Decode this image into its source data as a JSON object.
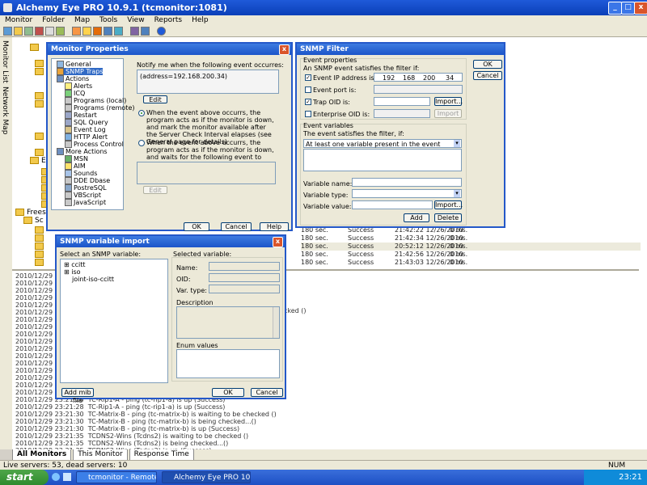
{
  "window": {
    "title": "Alchemy Eye PRO 10.9.1 (tcmonitor:1081)"
  },
  "menu": [
    "Monitor",
    "Folder",
    "Map",
    "Tools",
    "View",
    "Reports",
    "Help"
  ],
  "side_tabs": [
    "Monitor List",
    "Network Map"
  ],
  "tree": [
    {
      "label": "Freeser"
    },
    {
      "label": "Sc"
    }
  ],
  "monitor_rows": [
    {
      "interval": "180 sec.",
      "status": "Success",
      "time": "21:42:22 12/26/2010",
      "resp": "0 ms."
    },
    {
      "interval": "180 sec.",
      "status": "Success",
      "time": "21:42:34 12/26/2010",
      "resp": "0 ms."
    },
    {
      "interval": "180 sec.",
      "status": "Success",
      "time": "20:52:12 12/26/2010",
      "resp": "0 ms."
    },
    {
      "interval": "180 sec.",
      "status": "Success",
      "time": "21:42:56 12/26/2010",
      "resp": "0 ms."
    },
    {
      "interval": "180 sec.",
      "status": "Success",
      "time": "21:43:03 12/26/2010",
      "resp": "0 ms."
    }
  ],
  "log": {
    "dates": [
      "2010/12/29 23:2",
      "2010/12/29 23:2",
      "2010/12/29 23:2",
      "2010/12/29 23:2",
      "2010/12/29 23:2",
      "2010/12/29 23:2",
      "2010/12/29 23:2",
      "2010/12/29 23:2",
      "2010/12/29 23:2",
      "2010/12/29 23:2",
      "2010/12/29 23:2",
      "2010/12/29 23:2",
      "2010/12/29 23:2",
      "2010/12/29 23:2",
      "2010/12/29 23:2",
      "2010/12/29 23:2",
      "2010/12/29 23:2"
    ],
    "rows": [
      {
        "time": "2010/12/29 23:21:28",
        "text": "TC-Rip1-A - ping (tc-rip1-a) is up (Success)"
      },
      {
        "time": "2010/12/29 23:21:28",
        "text": "TC-Rip1-A - ping (tc-rip1-a) is up (Success)"
      },
      {
        "time": "2010/12/29 23:21:30",
        "text": "TC-Matrix-B - ping (tc-matrix-b) is waiting to be checked ()"
      },
      {
        "time": "2010/12/29 23:21:30",
        "text": "TC-Matrix-B - ping (tc-matrix-b) is being checked...()"
      },
      {
        "time": "2010/12/29 23:21:30",
        "text": "TC-Matrix-B - ping (tc-matrix-b) is up (Success)"
      },
      {
        "time": "2010/12/29 23:21:35",
        "text": "TCDNS2-Wins (Tcdns2) is waiting to be checked ()"
      },
      {
        "time": "2010/12/29 23:21:35",
        "text": "TCDNS2-Wins (Tcdns2) is being checked...()"
      },
      {
        "time": "2010/12/29 23:21:35",
        "text": "TCDNS2-Wins (Tcdns2) is up (Success)"
      }
    ],
    "fragment": "cked ()"
  },
  "tabs": [
    "All Monitors",
    "This Monitor",
    "Response Time"
  ],
  "statusbar": {
    "left": "Live servers: 53, dead servers: 10",
    "right": "NUM"
  },
  "taskbar": {
    "start": "start",
    "items": [
      "tcmonitor - Remote D...",
      "Alchemy Eye PRO 10...."
    ],
    "clock": "23:21"
  },
  "monitor_props": {
    "title": "Monitor Properties",
    "nav": [
      "General",
      "SNMP Traps",
      "Actions",
      "Alerts",
      "ICQ",
      "Programs (local)",
      "Programs (remote)",
      "Restart",
      "SQL Query",
      "Event Log",
      "HTTP Alert",
      "Process Control",
      "More Actions",
      "MSN",
      "AIM",
      "Sounds",
      "DDE Dbase",
      "PostreSQL",
      "VBScript",
      "JavaScript"
    ],
    "notify_label": "Notify me when the following event occurres:",
    "event_text": "(address=192.168.200.34)",
    "edit": "Edit",
    "radio1": "When the event above occurrs, the program acts as if the monitor is down, and mark the monitor available after the Server Check Interval elapses (see General page for details)",
    "radio2": "When the event above occurrs, the program acts as if the monitor is down, and waits for the following event to mark the monitor UP again:",
    "edit2": "Edit",
    "ok": "OK",
    "cancel": "Cancel",
    "help": "Help"
  },
  "snmp_filter": {
    "title": "SNMP Filter",
    "group1": "Event properties",
    "desc1": "An SNMP event satisfies the filter if:",
    "ip_label": "Event IP address is:",
    "ip": [
      "192",
      "168",
      "200",
      "34"
    ],
    "port_label": "Event port is:",
    "trap_label": "Trap OID is:",
    "ent_label": "Enterprise OID is:",
    "import": "Import...",
    "import2": "Import",
    "group2": "Event variables",
    "desc2": "The event satisfies the filter, if:",
    "cond": "At least one variable present in the event",
    "var_name": "Variable name:",
    "var_type": "Variable type:",
    "var_value": "Variable value:",
    "import3": "Import...",
    "add": "Add",
    "delete": "Delete",
    "ok": "OK",
    "cancel": "Cancel"
  },
  "snmp_import": {
    "title": "SNMP variable import",
    "select_label": "Select an SNMP variable:",
    "tree": [
      "ccitt",
      "iso",
      "joint-iso-ccitt"
    ],
    "selected_label": "Selected variable:",
    "name": "Name:",
    "oid": "OID:",
    "vartype": "Var. type:",
    "description": "Description",
    "enum": "Enum values",
    "add_mib": "Add mib file",
    "ok": "OK",
    "cancel": "Cancel"
  }
}
